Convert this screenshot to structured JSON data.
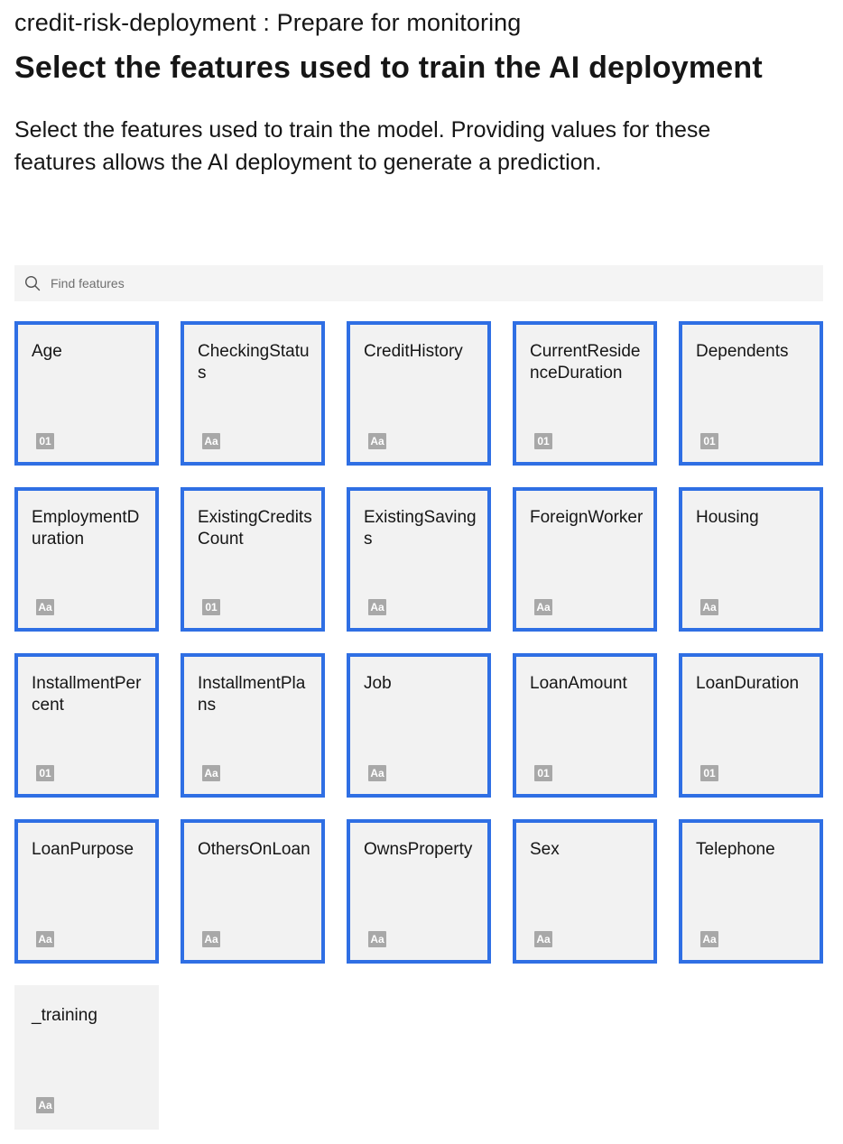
{
  "header": {
    "breadcrumb": "credit-risk-deployment : Prepare for monitoring",
    "title": "Select the features used to train the AI deployment",
    "description": "Select the features used to train the model. Providing values for these features allows the AI deployment to generate a prediction."
  },
  "search": {
    "placeholder": "Find features",
    "value": "",
    "icon": "search-icon"
  },
  "colors": {
    "selected_border": "#2f6fe4",
    "tile_background": "#f2f2f2",
    "badge_background": "#a8a8a8"
  },
  "features": [
    {
      "label": "Age",
      "type": "01",
      "selected": true
    },
    {
      "label": "CheckingStatus",
      "type": "Aa",
      "selected": true
    },
    {
      "label": "CreditHistory",
      "type": "Aa",
      "selected": true
    },
    {
      "label": "CurrentResidenceDuration",
      "type": "01",
      "selected": true
    },
    {
      "label": "Dependents",
      "type": "01",
      "selected": true
    },
    {
      "label": "EmploymentDuration",
      "type": "Aa",
      "selected": true
    },
    {
      "label": "ExistingCreditsCount",
      "type": "01",
      "selected": true
    },
    {
      "label": "ExistingSavings",
      "type": "Aa",
      "selected": true
    },
    {
      "label": "ForeignWorker",
      "type": "Aa",
      "selected": true
    },
    {
      "label": "Housing",
      "type": "Aa",
      "selected": true
    },
    {
      "label": "InstallmentPercent",
      "type": "01",
      "selected": true
    },
    {
      "label": "InstallmentPlans",
      "type": "Aa",
      "selected": true
    },
    {
      "label": "Job",
      "type": "Aa",
      "selected": true
    },
    {
      "label": "LoanAmount",
      "type": "01",
      "selected": true
    },
    {
      "label": "LoanDuration",
      "type": "01",
      "selected": true
    },
    {
      "label": "LoanPurpose",
      "type": "Aa",
      "selected": true
    },
    {
      "label": "OthersOnLoan",
      "type": "Aa",
      "selected": true
    },
    {
      "label": "OwnsProperty",
      "type": "Aa",
      "selected": true
    },
    {
      "label": "Sex",
      "type": "Aa",
      "selected": true
    },
    {
      "label": "Telephone",
      "type": "Aa",
      "selected": true
    },
    {
      "label": "_training",
      "type": "Aa",
      "selected": false
    }
  ]
}
